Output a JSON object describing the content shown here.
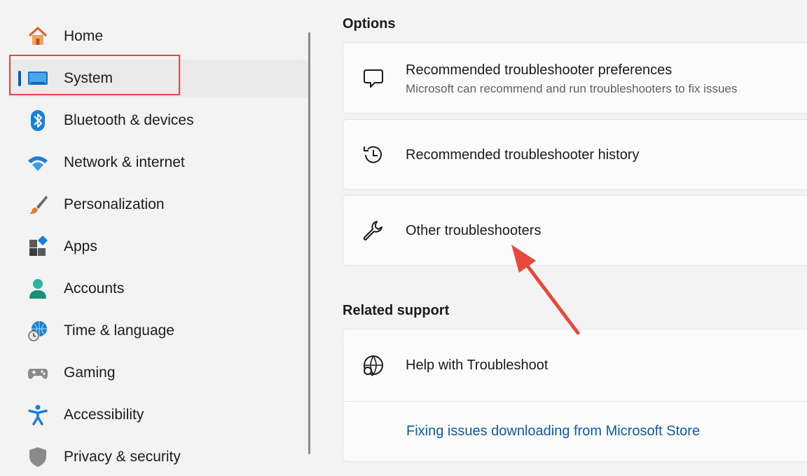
{
  "sidebar": {
    "items": [
      {
        "label": "Home",
        "icon": "home-icon"
      },
      {
        "label": "System",
        "icon": "monitor-icon",
        "selected": true
      },
      {
        "label": "Bluetooth & devices",
        "icon": "bluetooth-icon"
      },
      {
        "label": "Network & internet",
        "icon": "wifi-icon"
      },
      {
        "label": "Personalization",
        "icon": "paintbrush-icon"
      },
      {
        "label": "Apps",
        "icon": "apps-icon"
      },
      {
        "label": "Accounts",
        "icon": "person-icon"
      },
      {
        "label": "Time & language",
        "icon": "globe-clock-icon"
      },
      {
        "label": "Gaming",
        "icon": "gamepad-icon"
      },
      {
        "label": "Accessibility",
        "icon": "accessibility-icon"
      },
      {
        "label": "Privacy & security",
        "icon": "shield-icon"
      }
    ]
  },
  "main": {
    "options_title": "Options",
    "options": [
      {
        "title": "Recommended troubleshooter preferences",
        "subtitle": "Microsoft can recommend and run troubleshooters to fix issues",
        "icon": "chat-bubble-icon"
      },
      {
        "title": "Recommended troubleshooter history",
        "icon": "history-icon"
      },
      {
        "title": "Other troubleshooters",
        "icon": "wrench-icon"
      }
    ],
    "related_title": "Related support",
    "related": {
      "title": "Help with Troubleshoot",
      "icon": "globe-search-icon",
      "link": "Fixing issues downloading from Microsoft Store"
    }
  },
  "colors": {
    "accent": "#005fb8",
    "highlight_box": "#e8473c",
    "annotation_arrow": "#e8473c",
    "link": "#0f5aa8"
  }
}
